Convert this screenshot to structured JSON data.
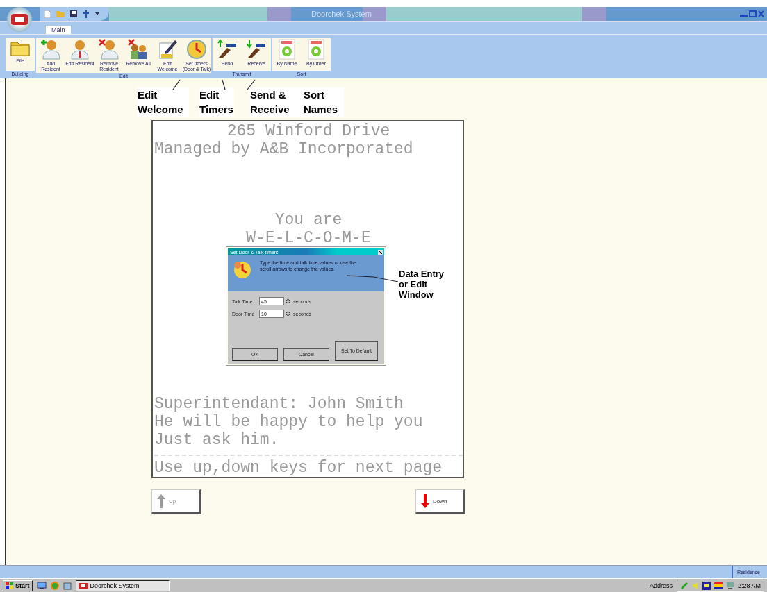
{
  "window": {
    "title": "Doorchek System"
  },
  "tabs": [
    {
      "label": "Main",
      "selected": true
    }
  ],
  "ribbon": {
    "groups": [
      {
        "label": "Building",
        "buttons": [
          {
            "label": "File"
          }
        ]
      },
      {
        "label": "Edit",
        "buttons": [
          {
            "label": "Add Resident"
          },
          {
            "label": "Edit Resident"
          },
          {
            "label": "Remove Resident"
          },
          {
            "label": "Remove All"
          },
          {
            "label": "Edit Welcome"
          },
          {
            "label": "Set timers (Door & Talk)"
          }
        ]
      },
      {
        "label": "Transmit",
        "buttons": [
          {
            "label": "Send"
          },
          {
            "label": "Receive"
          }
        ]
      },
      {
        "label": "Sort",
        "buttons": [
          {
            "label": "By Name"
          },
          {
            "label": "By Order"
          }
        ]
      }
    ]
  },
  "annotations": [
    {
      "text": "Edit Welcome"
    },
    {
      "text": "Edit Timers"
    },
    {
      "text": "Send & Receive"
    },
    {
      "text": "Sort Names"
    },
    {
      "text": "Data Entry or Edit Window"
    }
  ],
  "document": {
    "header": [
      "265 Winford Drive",
      "Managed by A&B Incorporated"
    ],
    "welcome": [
      "You are",
      "W-E-L-C-O-M-E"
    ],
    "footer": [
      "Superintendant: John Smith",
      "He will be happy to help you",
      "Just ask him."
    ],
    "hint": "Use up,down keys for next page"
  },
  "nav_buttons": [
    {
      "label": "Up",
      "disabled": true
    },
    {
      "label": "Down",
      "disabled": false
    }
  ],
  "dialog": {
    "title": "Set Door & Talk timers",
    "message": "Type the time and talk time values or use the scroll arrows to change the values.",
    "fields": [
      {
        "label": "Talk Time",
        "value": "45",
        "unit": "seconds"
      },
      {
        "label": "Door Time",
        "value": "10",
        "unit": "seconds"
      }
    ],
    "buttons": [
      "OK",
      "Cancel",
      "Set To Default"
    ]
  },
  "status_bar": {
    "text": "Residence"
  },
  "taskbar": {
    "start": "Start",
    "tasks": [
      {
        "label": "Doorchek System"
      }
    ],
    "address_label": "Address",
    "clock": "2:28 AM"
  }
}
